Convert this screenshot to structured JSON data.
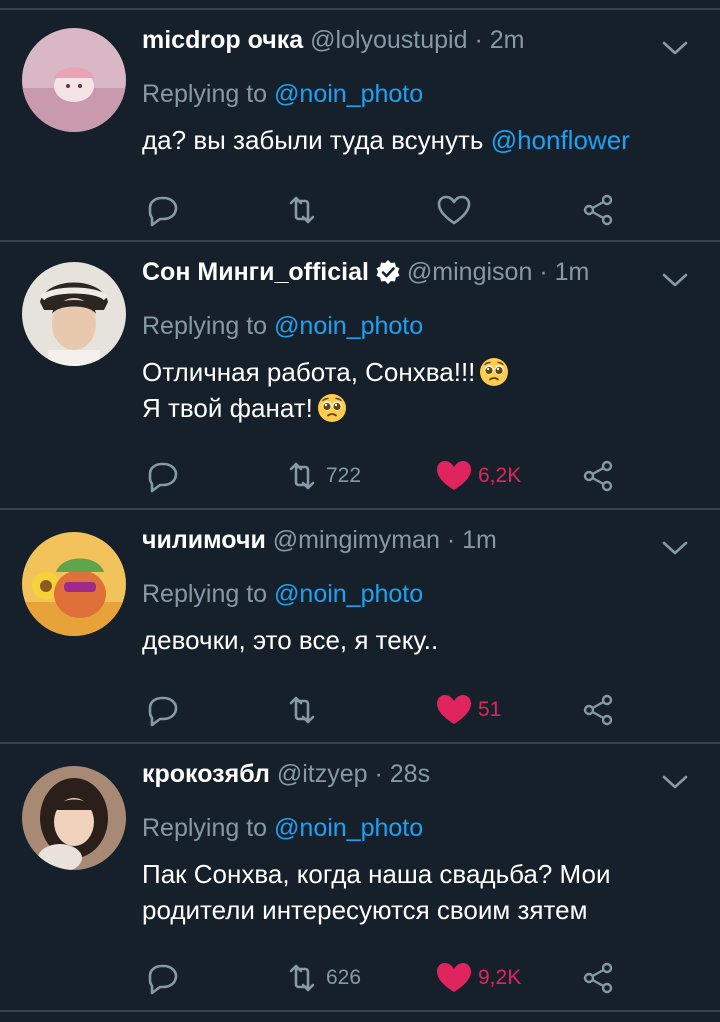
{
  "tweets": [
    {
      "name": "micdrop очка",
      "handle": "@lolyoustupid",
      "time": "2m",
      "replying_prefix": "Replying to",
      "replying_to": "@noin_photo",
      "text_before": "да? вы забыли туда всунуть",
      "text_mention": "@honflower",
      "retweets": "",
      "likes": "",
      "liked": false
    },
    {
      "name": "Сон Минги_official",
      "verified": true,
      "handle": "@mingison",
      "time": "1m",
      "replying_prefix": "Replying to",
      "replying_to": "@noin_photo",
      "text_line1": "Отличная работа, Сонхва!!!",
      "text_line2": "Я твой фанат!",
      "retweets": "722",
      "likes": "6,2K",
      "liked": true
    },
    {
      "name": "чилимочи",
      "handle": "@mingimyman",
      "time": "1m",
      "replying_prefix": "Replying to",
      "replying_to": "@noin_photo",
      "text": "девочки, это все, я теку..",
      "retweets": "",
      "likes": "51",
      "liked": true
    },
    {
      "name": "крокозябл",
      "handle": "@itzyep",
      "time": "28s",
      "replying_prefix": "Replying to",
      "replying_to": "@noin_photo",
      "text_line1": "Пак Сонхва, когда наша свадьба? Мои",
      "text_line2": "родители интересуются своим зятем",
      "retweets": "626",
      "likes": "9,2K",
      "liked": true
    }
  ],
  "colors": {
    "background": "#15202b",
    "divider": "#38444d",
    "secondary_text": "#8899a6",
    "link": "#1da1f2",
    "like": "#e0245e"
  },
  "icons": [
    "reply-icon",
    "retweet-icon",
    "heart-icon",
    "share-icon",
    "chevron-down-icon",
    "verified-badge-icon",
    "pleading-face-emoji"
  ]
}
